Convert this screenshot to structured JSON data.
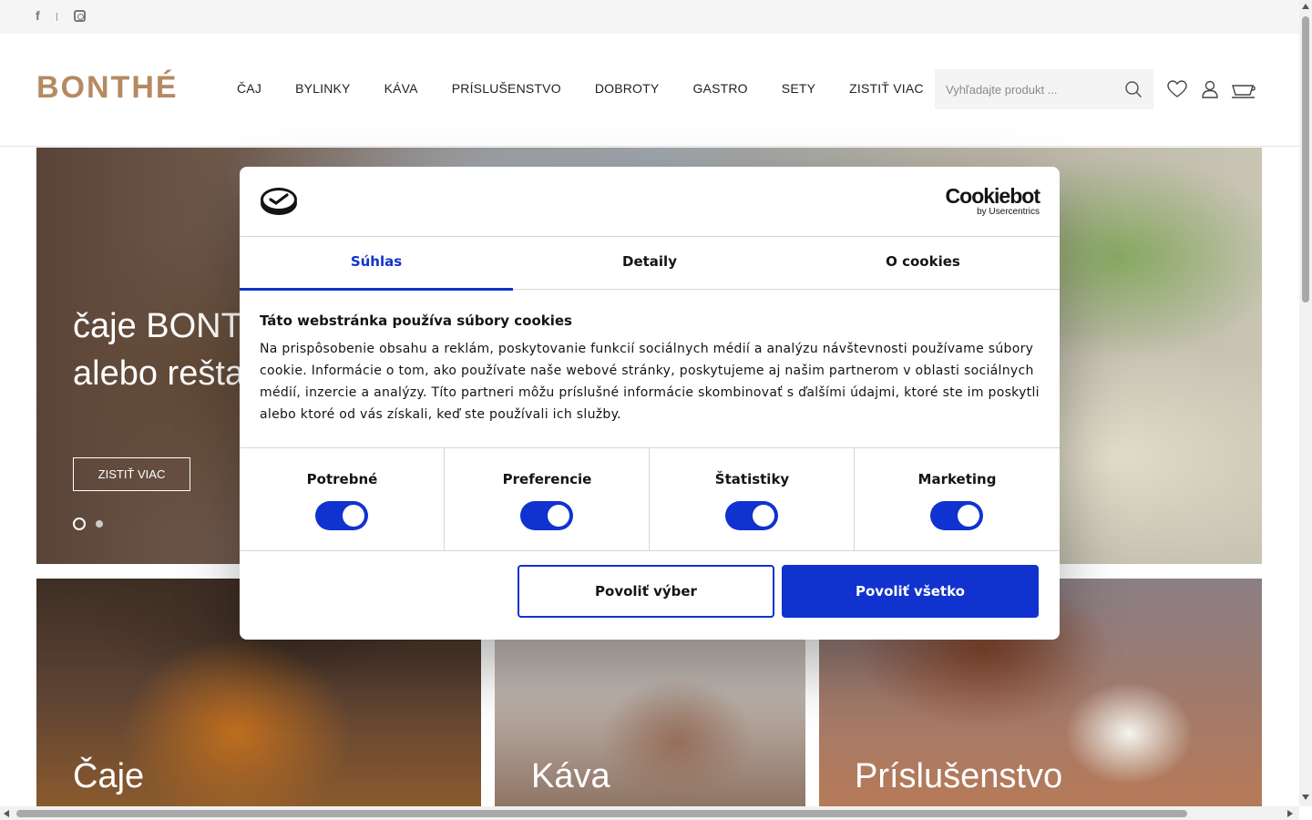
{
  "social": {
    "facebook_glyph": "f",
    "icons": [
      "facebook-icon",
      "instagram-icon"
    ]
  },
  "header": {
    "logo": "BONTHÉ",
    "nav": [
      "ČAJ",
      "BYLINKY",
      "KÁVA",
      "PRÍSLUŠENSTVO",
      "DOBROTY",
      "GASTRO",
      "SETY",
      "ZISTIŤ VIAC"
    ],
    "search_placeholder": "Vyhľadajte produkt ...",
    "icons": [
      "search-icon",
      "heart-icon",
      "user-icon",
      "cart-icon"
    ],
    "logo_color": "#b58a62"
  },
  "hero": {
    "title": "čaje BONTHÉ pre kaviarne\nalebo reštaurácie",
    "cta": "ZISTIŤ VIAC",
    "slides": 2,
    "active_slide": 1
  },
  "categories": [
    "Čaje",
    "Káva",
    "Príslušenstvo"
  ],
  "cookie_dialog": {
    "brand_name": "Cookiebot",
    "brand_sub": "by Usercentrics",
    "tabs": [
      "Súhlas",
      "Detaily",
      "O cookies"
    ],
    "active_tab": "Súhlas",
    "title": "Táto webstránka používa súbory cookies",
    "text": "Na prispôsobenie obsahu a reklám, poskytovanie funkcií sociálnych médií a analýzu návštevnosti používame súbory cookie. Informácie o tom, ako používate naše webové stránky, poskytujeme aj našim partnerom v oblasti sociálnych médií, inzercie a analýzy. Títo partneri môžu príslušné informácie skombinovať s ďalšími údajmi, ktoré ste im poskytli alebo ktoré od vás získali, keď ste používali ich služby.",
    "categories": [
      {
        "name": "Potrebné",
        "enabled": true
      },
      {
        "name": "Preferencie",
        "enabled": true
      },
      {
        "name": "Štatistiky",
        "enabled": true
      },
      {
        "name": "Marketing",
        "enabled": true
      }
    ],
    "btn_selection": "Povoliť výber",
    "btn_all": "Povoliť všetko",
    "accent_color": "#1032cf"
  }
}
